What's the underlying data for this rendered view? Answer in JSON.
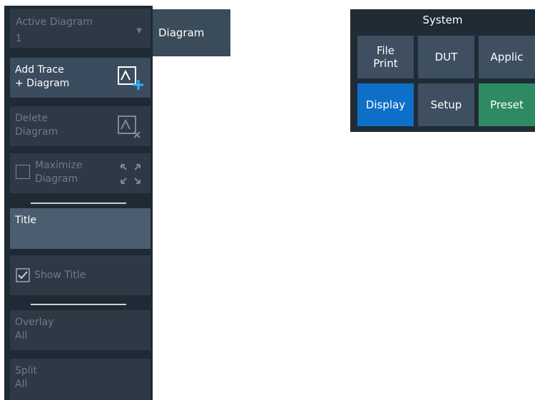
{
  "left_panel": {
    "active_diagram": {
      "label": "Active Diagram",
      "value": "1"
    },
    "add_trace": {
      "label": "Add Trace\n+ Diagram"
    },
    "delete_diagram": {
      "label": "Delete\nDiagram"
    },
    "maximize_diagram": {
      "label": "Maximize\nDiagram"
    },
    "title": {
      "label": "Title"
    },
    "show_title": {
      "label": "Show Title"
    },
    "overlay_all": {
      "label": "Overlay\nAll"
    },
    "split_all": {
      "label": "Split\nAll"
    }
  },
  "diagram_tab": {
    "label": "Diagram"
  },
  "system": {
    "title": "System",
    "buttons": [
      {
        "label": "File\nPrint"
      },
      {
        "label": "DUT"
      },
      {
        "label": "Applic"
      },
      {
        "label": "Display"
      },
      {
        "label": "Setup"
      },
      {
        "label": "Preset"
      }
    ]
  },
  "colors": {
    "accent": "#0e6fc8",
    "preset": "#2e8a63",
    "panel": "#1e2a34"
  }
}
